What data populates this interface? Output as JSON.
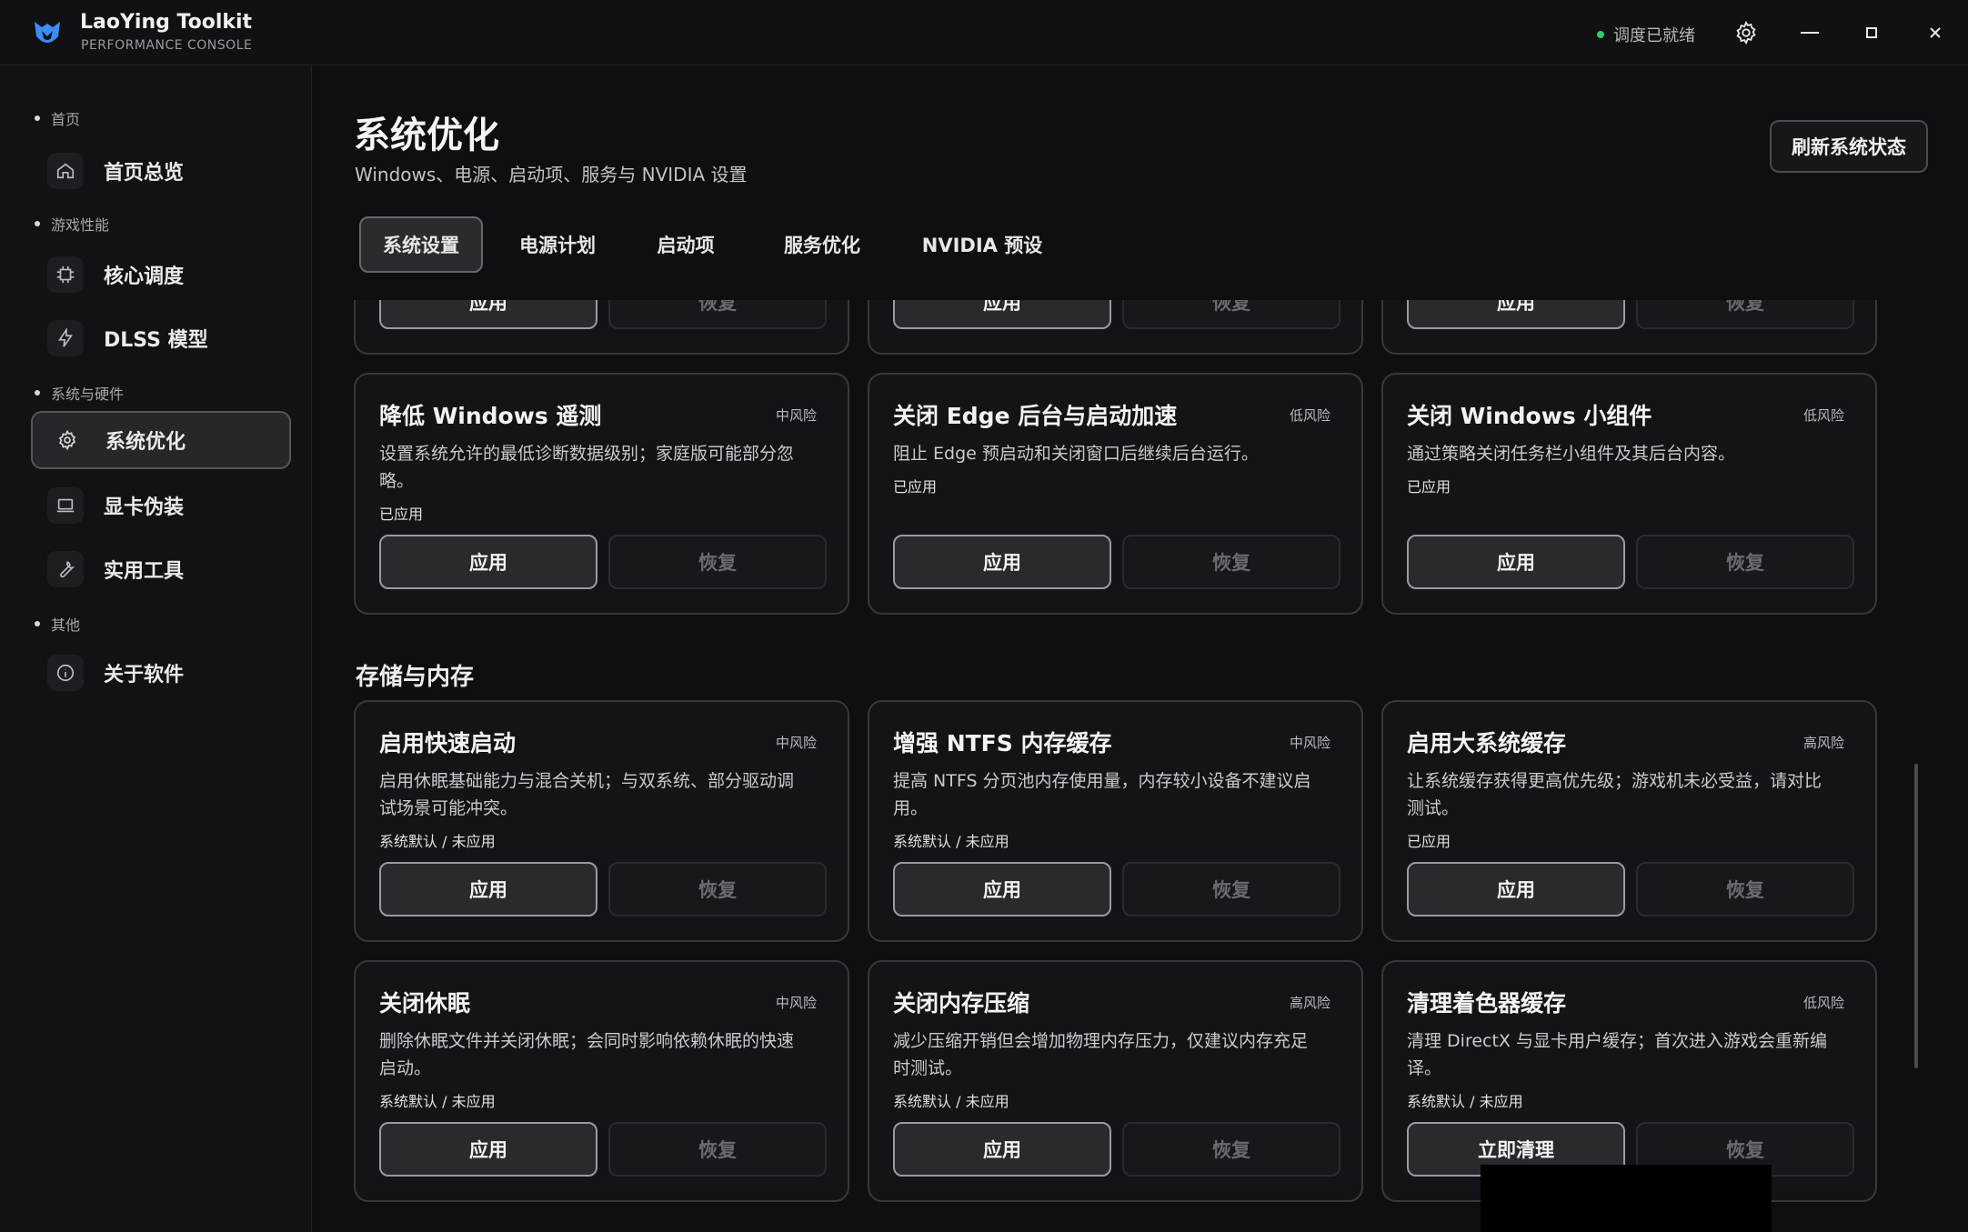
{
  "app": {
    "name": "LaoYing Toolkit",
    "subtitle": "PERFORMANCE CONSOLE",
    "status": "调度已就绪"
  },
  "sidebar": {
    "sections": [
      {
        "label": "首页",
        "items": [
          {
            "label": "首页总览",
            "icon": "home-icon"
          }
        ]
      },
      {
        "label": "游戏性能",
        "items": [
          {
            "label": "核心调度",
            "icon": "chip-icon"
          },
          {
            "label": "DLSS 模型",
            "icon": "bolt-icon"
          }
        ]
      },
      {
        "label": "系统与硬件",
        "items": [
          {
            "label": "系统优化",
            "icon": "gear-icon"
          },
          {
            "label": "显卡伪装",
            "icon": "laptop-icon"
          },
          {
            "label": "实用工具",
            "icon": "wrench-icon"
          }
        ]
      },
      {
        "label": "其他",
        "items": [
          {
            "label": "关于软件",
            "icon": "info-icon"
          }
        ]
      }
    ],
    "active": "系统优化"
  },
  "page": {
    "title": "系统优化",
    "subtitle": "Windows、电源、启动项、服务与 NVIDIA 设置",
    "refresh_label": "刷新系统状态"
  },
  "tabs": [
    "系统设置",
    "电源计划",
    "启动项",
    "服务优化",
    "NVIDIA 预设"
  ],
  "active_tab": "系统设置",
  "partial_row": {
    "apply_label": "应用",
    "restore_label": "恢复"
  },
  "cards_row1": [
    {
      "title": "降低 Windows 遥测",
      "risk": "中风险",
      "desc": "设置系统允许的最低诊断数据级别；家庭版可能部分忽略。",
      "status": "已应用",
      "apply": "应用",
      "restore": "恢复"
    },
    {
      "title": "关闭 Edge 后台与启动加速",
      "risk": "低风险",
      "desc": "阻止 Edge 预启动和关闭窗口后继续后台运行。",
      "status": "已应用",
      "apply": "应用",
      "restore": "恢复"
    },
    {
      "title": "关闭 Windows 小组件",
      "risk": "低风险",
      "desc": "通过策略关闭任务栏小组件及其后台内容。",
      "status": "已应用",
      "apply": "应用",
      "restore": "恢复"
    }
  ],
  "section_storage": {
    "title": "存储与内存",
    "cards": [
      {
        "title": "启用快速启动",
        "risk": "中风险",
        "desc": "启用休眠基础能力与混合关机；与双系统、部分驱动调试场景可能冲突。",
        "status": "系统默认 / 未应用",
        "apply": "应用",
        "restore": "恢复"
      },
      {
        "title": "增强 NTFS 内存缓存",
        "risk": "中风险",
        "desc": "提高 NTFS 分页池内存使用量，内存较小设备不建议启用。",
        "status": "系统默认 / 未应用",
        "apply": "应用",
        "restore": "恢复"
      },
      {
        "title": "启用大系统缓存",
        "risk": "高风险",
        "desc": "让系统缓存获得更高优先级；游戏机未必受益，请对比测试。",
        "status": "已应用",
        "apply": "应用",
        "restore": "恢复"
      },
      {
        "title": "关闭休眠",
        "risk": "中风险",
        "desc": "删除休眠文件并关闭休眠；会同时影响依赖休眠的快速启动。",
        "status": "系统默认 / 未应用",
        "apply": "应用",
        "restore": "恢复"
      },
      {
        "title": "关闭内存压缩",
        "risk": "高风险",
        "desc": "减少压缩开销但会增加物理内存压力，仅建议内存充足时测试。",
        "status": "系统默认 / 未应用",
        "apply": "应用",
        "restore": "恢复"
      },
      {
        "title": "清理着色器缓存",
        "risk": "低风险",
        "desc": "清理 DirectX 与显卡用户缓存；首次进入游戏会重新编译。",
        "status": "系统默认 / 未应用",
        "apply": "立即清理",
        "restore": "恢复"
      }
    ]
  }
}
